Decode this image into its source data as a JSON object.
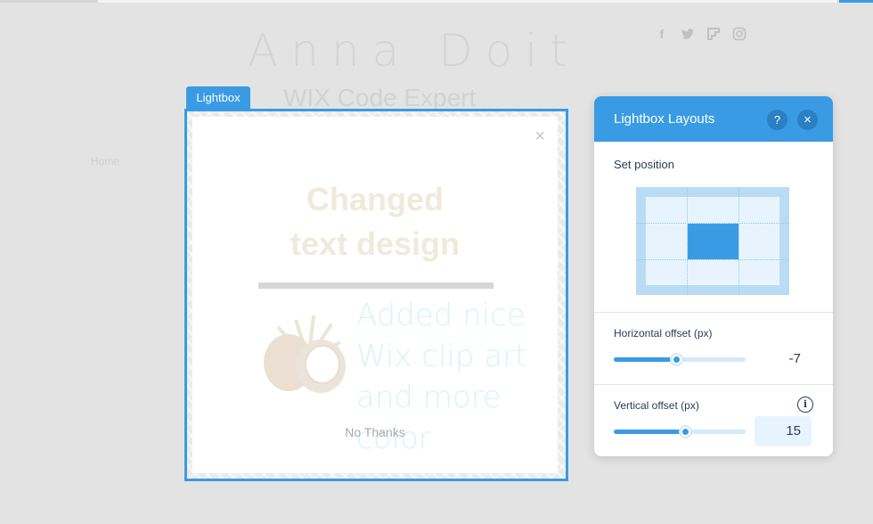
{
  "site": {
    "title": "Anna Doit",
    "subtitle": "WIX Code Expert",
    "nav_home": "Home",
    "social_icons": [
      "facebook-icon",
      "twitter-icon",
      "flipboard-icon",
      "instagram-icon"
    ]
  },
  "lightbox": {
    "tab_label": "Lightbox",
    "close_glyph": "×",
    "heading_line1": "Changed",
    "heading_line2": "text design",
    "script_line1": "Added nice",
    "script_line2": "Wix clip art",
    "script_line3": "and more color",
    "no_thanks": "No Thanks"
  },
  "panel": {
    "title": "Lightbox Layouts",
    "help_glyph": "?",
    "close_glyph": "×",
    "set_position_label": "Set position",
    "selected_position": "center",
    "horizontal": {
      "label": "Horizontal offset (px)",
      "value": "-7",
      "slider_fraction": 0.47
    },
    "vertical": {
      "label": "Vertical offset (px)",
      "value": "15",
      "slider_fraction": 0.54,
      "info_glyph": "i"
    }
  },
  "colors": {
    "accent": "#3a9be5",
    "panel_text": "#2b3d57"
  }
}
